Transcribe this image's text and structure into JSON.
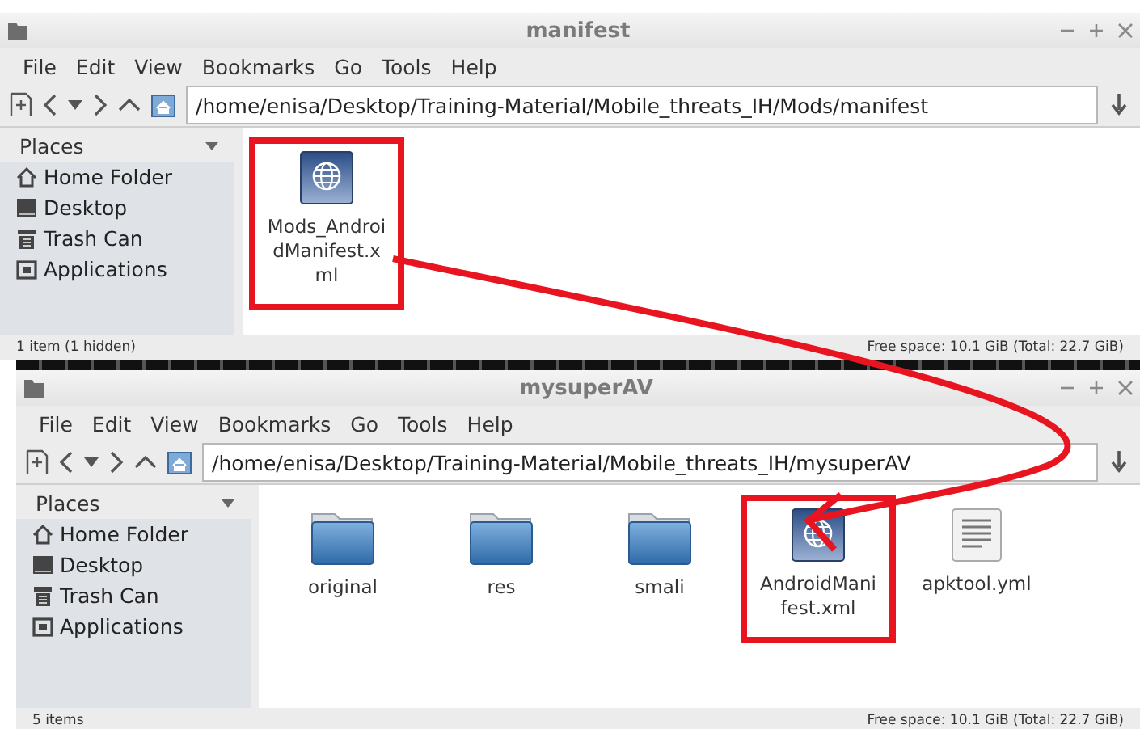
{
  "windows": [
    {
      "title": "manifest",
      "menu": [
        "File",
        "Edit",
        "View",
        "Bookmarks",
        "Go",
        "Tools",
        "Help"
      ],
      "path": "/home/enisa/Desktop/Training-Material/Mobile_threats_IH/Mods/manifest",
      "places_label": "Places",
      "places": [
        {
          "label": "Home Folder",
          "kind": "home"
        },
        {
          "label": "Desktop",
          "kind": "desktop"
        },
        {
          "label": "Trash Can",
          "kind": "trash"
        },
        {
          "label": "Applications",
          "kind": "apps"
        }
      ],
      "items": [
        {
          "name": "Mods_AndroidManifest.xml",
          "kind": "web",
          "highlighted": true
        }
      ],
      "status": "1 item (1 hidden)",
      "free_space": "Free space: 10.1 GiB (Total: 22.7 GiB)"
    },
    {
      "title": "mysuperAV",
      "menu": [
        "File",
        "Edit",
        "View",
        "Bookmarks",
        "Go",
        "Tools",
        "Help"
      ],
      "path": "/home/enisa/Desktop/Training-Material/Mobile_threats_IH/mysuperAV",
      "places_label": "Places",
      "places": [
        {
          "label": "Home Folder",
          "kind": "home"
        },
        {
          "label": "Desktop",
          "kind": "desktop"
        },
        {
          "label": "Trash Can",
          "kind": "trash"
        },
        {
          "label": "Applications",
          "kind": "apps"
        }
      ],
      "items": [
        {
          "name": "original",
          "kind": "folder",
          "highlighted": false
        },
        {
          "name": "res",
          "kind": "folder",
          "highlighted": false
        },
        {
          "name": "smali",
          "kind": "folder",
          "highlighted": false
        },
        {
          "name": "AndroidManifest.xml",
          "kind": "web",
          "highlighted": true
        },
        {
          "name": "apktool.yml",
          "kind": "text",
          "highlighted": false
        }
      ],
      "status": "5 items",
      "free_space": "Free space: 10.1 GiB (Total: 22.7 GiB)"
    }
  ]
}
